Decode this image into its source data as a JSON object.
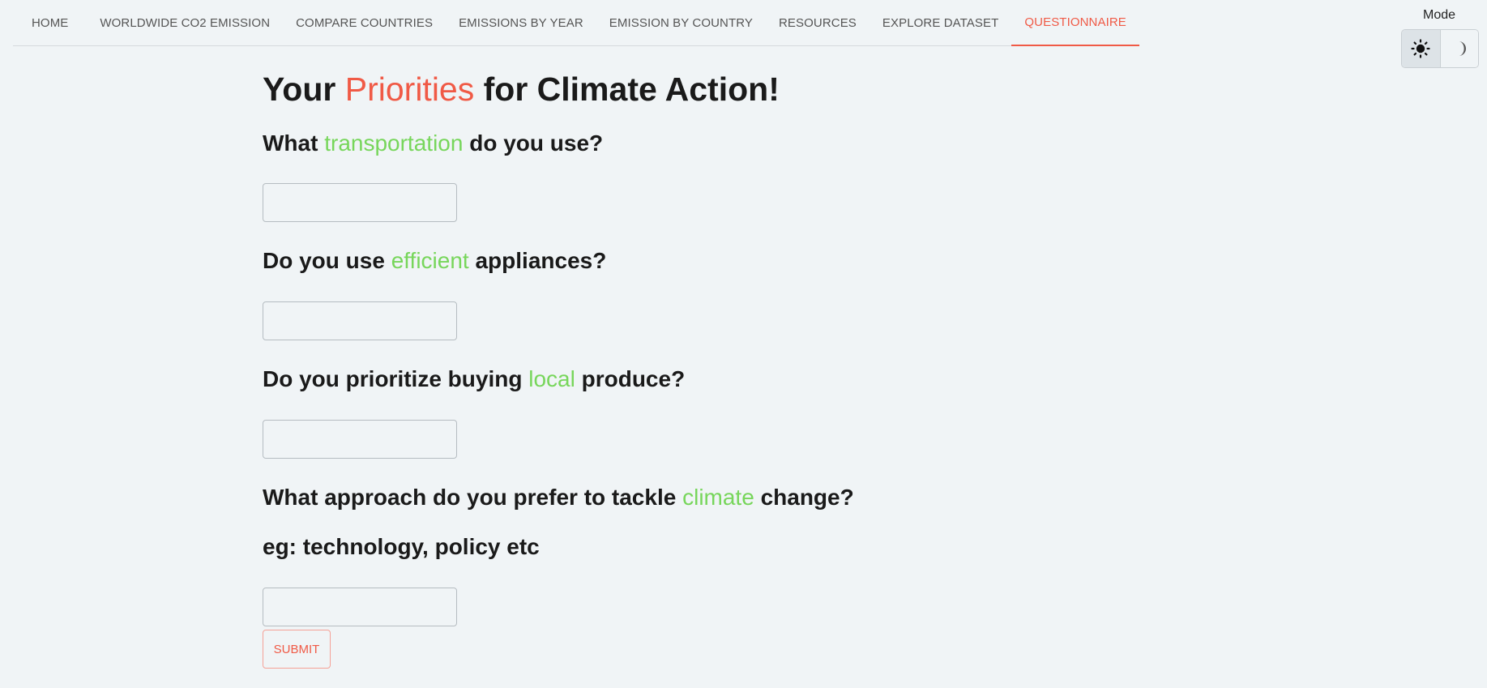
{
  "nav": {
    "items": [
      {
        "label": "HOME"
      },
      {
        "label": "WORLDWIDE CO2 EMISSION"
      },
      {
        "label": "COMPARE COUNTRIES"
      },
      {
        "label": "EMISSIONS BY YEAR"
      },
      {
        "label": "EMISSION BY COUNTRY"
      },
      {
        "label": "RESOURCES"
      },
      {
        "label": "EXPLORE DATASET"
      },
      {
        "label": "QUESTIONNAIRE",
        "active": true
      }
    ]
  },
  "mode": {
    "label": "Mode",
    "options": [
      {
        "icon": "sun-icon",
        "selected": true
      },
      {
        "icon": "moon-icon",
        "selected": false
      }
    ]
  },
  "form": {
    "title": {
      "pre": "Your ",
      "accent": "Priorities",
      "post": " for Climate Action!"
    },
    "questions": [
      {
        "pre": "What ",
        "accent": "transportation",
        "post": " do you use?",
        "value": ""
      },
      {
        "pre": "Do you use ",
        "accent": "efficient",
        "post": " appliances?",
        "value": ""
      },
      {
        "pre": "Do you prioritize buying ",
        "accent": "local",
        "post": " produce?",
        "value": ""
      },
      {
        "pre": "What approach do you prefer to tackle ",
        "accent": "climate",
        "post": " change?",
        "hint": "eg: technology, policy etc",
        "value": ""
      }
    ],
    "submit_label": "SUBMIT"
  },
  "colors": {
    "accent_red": "#f05a46",
    "accent_green": "#77d65b",
    "background": "#f0f4f6"
  }
}
